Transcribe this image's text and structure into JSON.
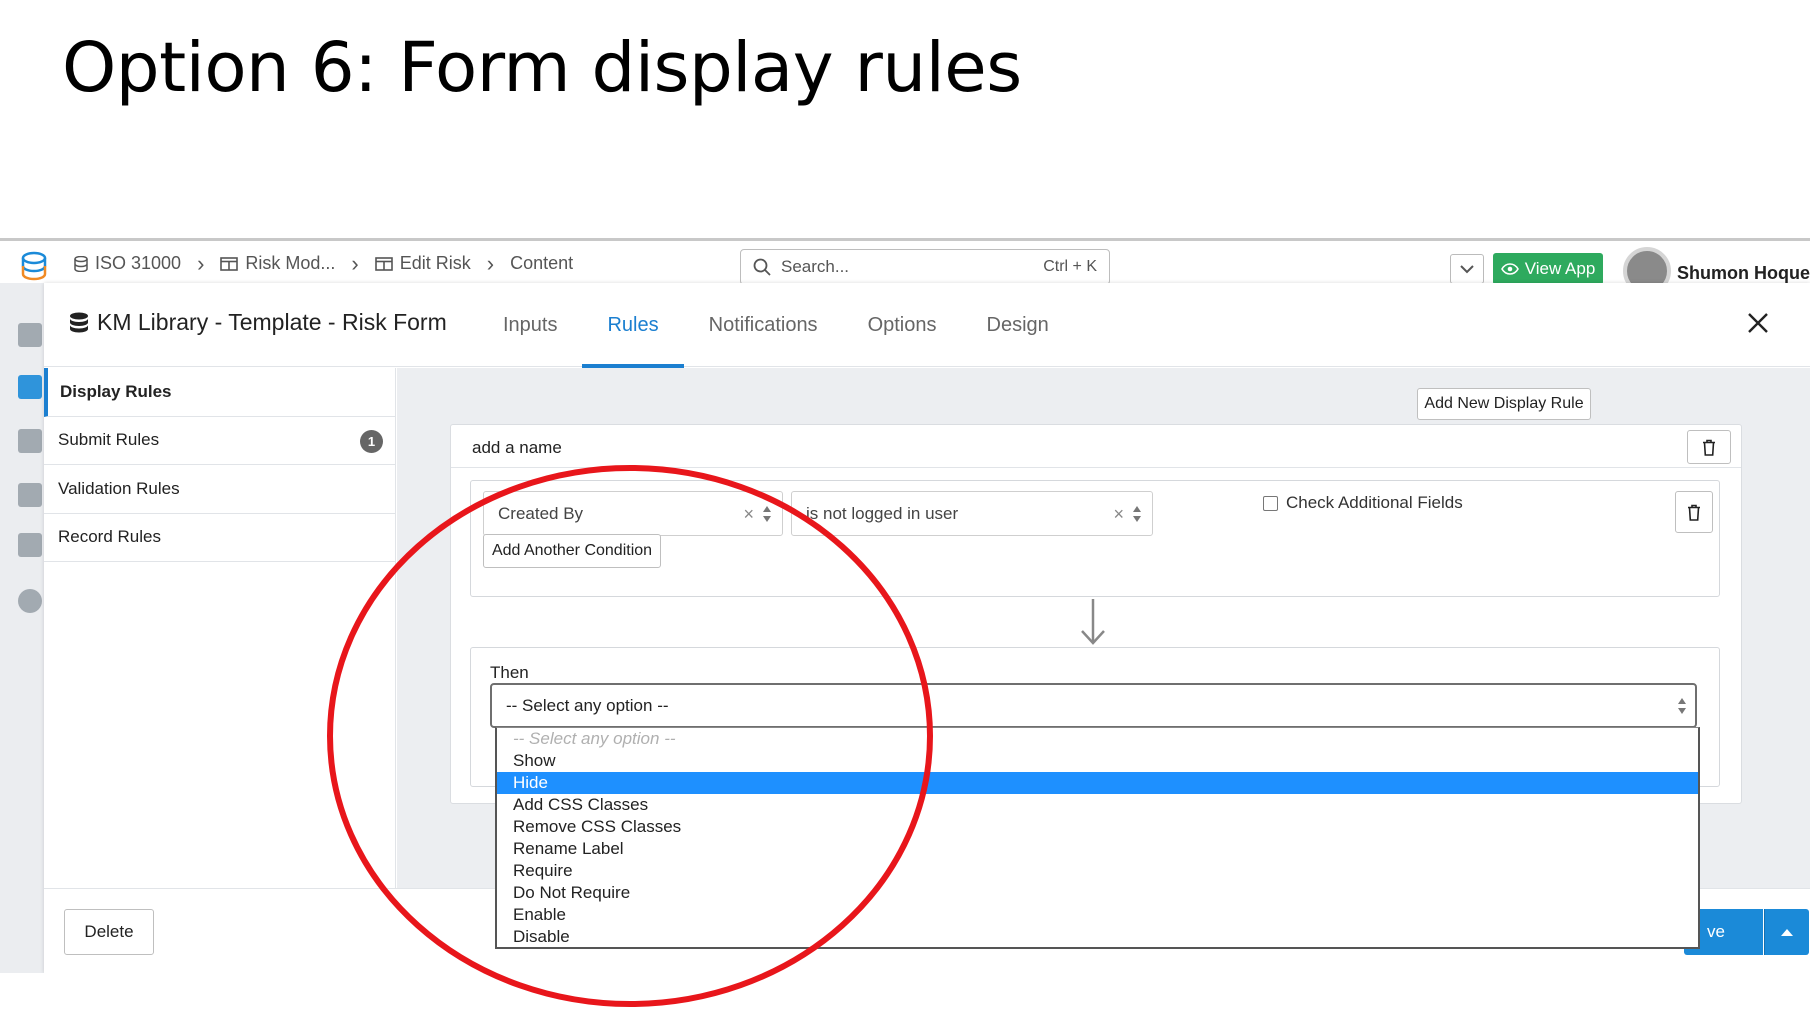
{
  "slide": {
    "title": "Option 6: Form display rules"
  },
  "topbar": {
    "breadcrumbs": [
      {
        "label": "ISO 31000",
        "icon": "database-icon"
      },
      {
        "label": "Risk Mod...",
        "icon": "table-icon"
      },
      {
        "label": "Edit Risk",
        "icon": "table-icon"
      },
      {
        "label": "Content",
        "icon": ""
      }
    ],
    "search_placeholder": "Search...",
    "search_shortcut": "Ctrl + K",
    "view_app_label": "View App",
    "user_name": "Shumon Hoque"
  },
  "modal": {
    "title": "KM Library - Template - Risk Form",
    "tabs": [
      {
        "label": "Inputs",
        "active": false
      },
      {
        "label": "Rules",
        "active": true
      },
      {
        "label": "Notifications",
        "active": false
      },
      {
        "label": "Options",
        "active": false
      },
      {
        "label": "Design",
        "active": false
      }
    ],
    "sidenav": [
      {
        "label": "Display Rules",
        "active": true,
        "badge": ""
      },
      {
        "label": "Submit Rules",
        "active": false,
        "badge": "1"
      },
      {
        "label": "Validation Rules",
        "active": false,
        "badge": ""
      },
      {
        "label": "Record Rules",
        "active": false,
        "badge": ""
      }
    ],
    "add_rule_label": "Add New Display Rule",
    "rule": {
      "name": "add a name",
      "condition_field": "Created By",
      "condition_operator": "is not logged in user",
      "check_additional_label": "Check Additional Fields",
      "add_condition_label": "Add Another Condition",
      "then_label": "Then",
      "then_select_value": "-- Select any option --",
      "then_options": [
        "-- Select any option --",
        "Show",
        "Hide",
        "Add CSS Classes",
        "Remove CSS Classes",
        "Rename Label",
        "Require",
        "Do Not Require",
        "Enable",
        "Disable"
      ],
      "highlighted_option": "Hide"
    },
    "footer": {
      "delete_label": "Delete",
      "save_label": "ve"
    }
  },
  "colors": {
    "accent": "#1b7fd0",
    "view_app": "#2eaa5e",
    "option_selected": "#1e90ff",
    "highlight_circle": "#e8161b"
  }
}
